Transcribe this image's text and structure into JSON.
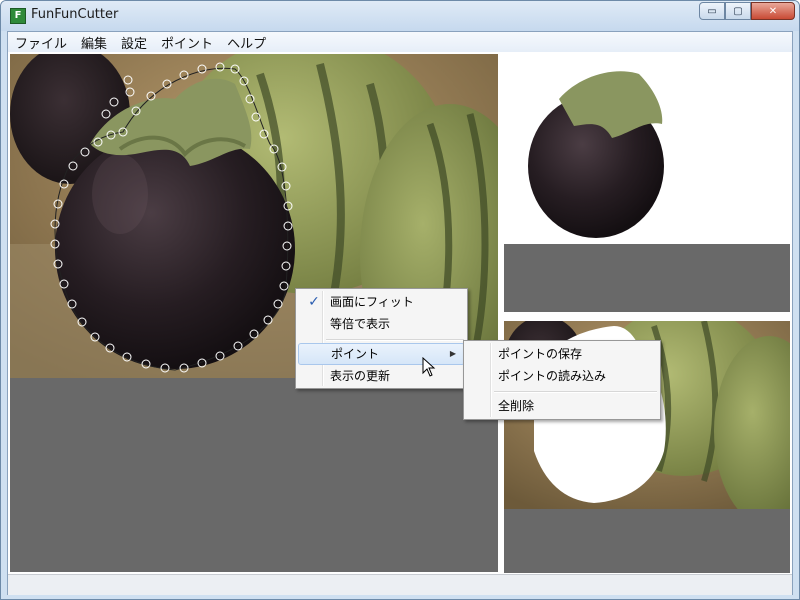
{
  "window": {
    "title": "FunFunCutter",
    "app_icon_letter": "F",
    "buttons": {
      "minimize": "▭",
      "maximize": "▢",
      "close": "✕"
    }
  },
  "menubar": {
    "items": [
      "ファイル",
      "編集",
      "設定",
      "ポイント",
      "ヘルプ"
    ]
  },
  "context_menu": {
    "items": [
      {
        "label": "画面にフィット",
        "checked": true
      },
      {
        "label": "等倍で表示"
      },
      {
        "label": "ポイント",
        "submenu": true,
        "highlighted": true
      },
      {
        "label": "表示の更新"
      }
    ],
    "check_glyph": "✓",
    "submenu_arrow": "▶"
  },
  "submenu": {
    "items": [
      {
        "label": "ポイントの保存"
      },
      {
        "label": "ポイントの読み込み"
      },
      {
        "label": "全削除"
      }
    ]
  },
  "colors": {
    "pane_gray": "#696969",
    "selection_line": "#222222"
  }
}
